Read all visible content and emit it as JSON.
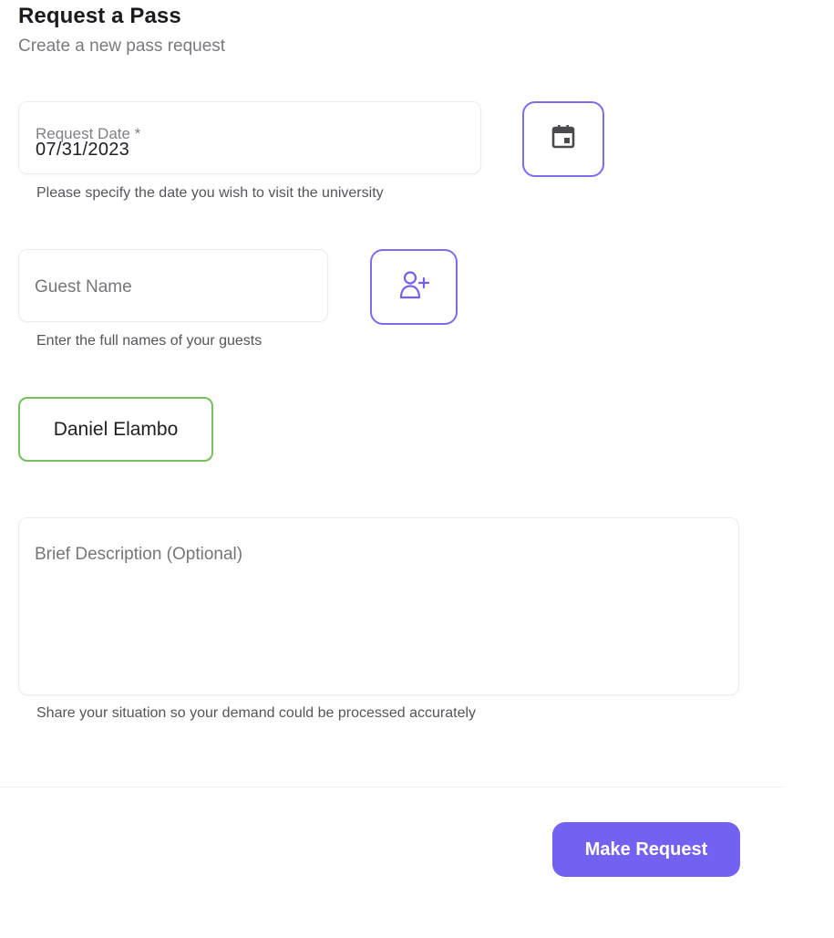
{
  "header": {
    "title": "Request a Pass",
    "subtitle": "Create a new pass request"
  },
  "form": {
    "request_date": {
      "label": "Request Date *",
      "value": "07/31/2023",
      "helper": "Please specify the date you wish to visit the university",
      "icon": "calendar-icon"
    },
    "guest_name": {
      "placeholder": "Guest Name",
      "value": "",
      "helper": "Enter the full names of your guests",
      "icon": "person-add-icon"
    },
    "guests": [
      {
        "name": "Daniel Elambo"
      }
    ],
    "description": {
      "placeholder": "Brief Description (Optional)",
      "value": "",
      "helper": "Share your situation so your demand could be processed accurately"
    },
    "submit_label": "Make Request"
  },
  "colors": {
    "accent": "#7362f1",
    "accent_border": "#7b6cf0",
    "chip_border": "#74c05a",
    "helper_text": "#55555a",
    "subtitle_text": "#7a7a7f"
  }
}
